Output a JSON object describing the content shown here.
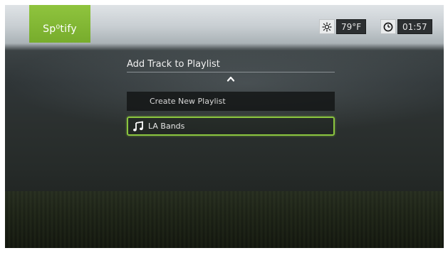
{
  "app": {
    "logo_text": "Sp⁰tify",
    "brand_color": "#8bc53f"
  },
  "status_bar": {
    "weather_icon": "sun-icon",
    "temperature": "79°F",
    "clock_icon": "clock-icon",
    "time": "01:57"
  },
  "dialog": {
    "title": "Add Track to Playlist",
    "scroll_up_icon": "chevron-up-icon",
    "items": [
      {
        "label": "Create New Playlist",
        "selected": false
      },
      {
        "label": "LA Bands",
        "icon": "music-note-icon",
        "selected": true
      }
    ]
  }
}
